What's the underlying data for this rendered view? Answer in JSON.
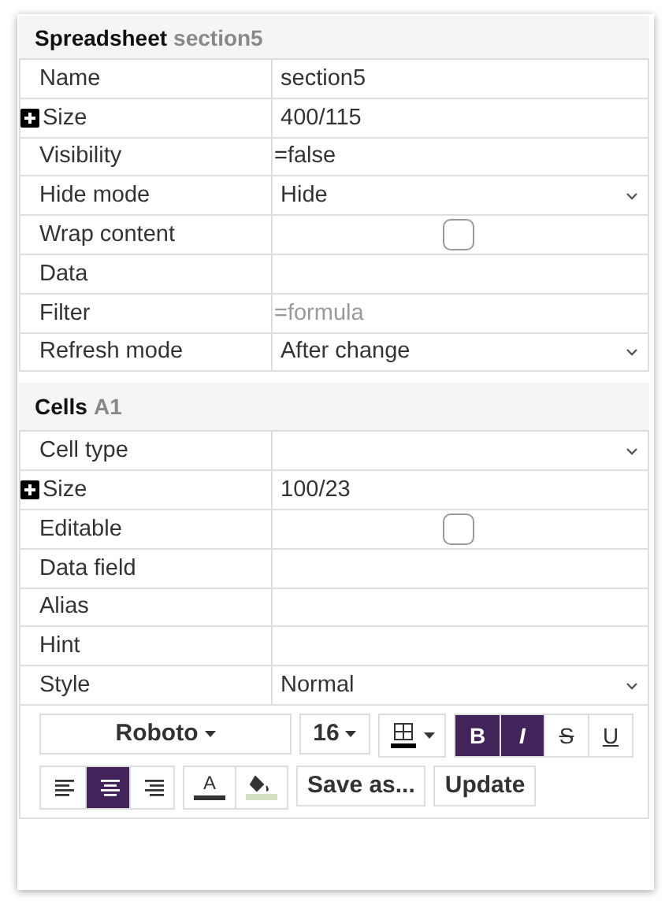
{
  "sections": [
    {
      "title": "Spreadsheet",
      "subtitle": "section5",
      "rows": [
        {
          "label": "Name",
          "kind": "text",
          "value": "section5",
          "expandable": false
        },
        {
          "label": "Size",
          "kind": "text",
          "value": "400/115",
          "expandable": true
        },
        {
          "label": "Visibility",
          "kind": "formula",
          "value": "=false",
          "expandable": false
        },
        {
          "label": "Hide mode",
          "kind": "select",
          "value": "Hide",
          "expandable": false
        },
        {
          "label": "Wrap content",
          "kind": "checkbox",
          "checked": false,
          "expandable": false
        },
        {
          "label": "Data",
          "kind": "text",
          "expandable": false
        },
        {
          "label": "Filter",
          "kind": "formula",
          "placeholder": "=formula",
          "expandable": false
        },
        {
          "label": "Refresh mode",
          "kind": "select",
          "value": "After change",
          "expandable": false
        }
      ]
    },
    {
      "title": "Cells",
      "subtitle": "A1",
      "rows": [
        {
          "label": "Cell type",
          "kind": "select",
          "expandable": false
        },
        {
          "label": "Size",
          "kind": "text",
          "value": "100/23",
          "expandable": true
        },
        {
          "label": "Editable",
          "kind": "checkbox",
          "checked": false,
          "expandable": false
        },
        {
          "label": "Data field",
          "kind": "text",
          "expandable": false
        },
        {
          "label": "Alias",
          "kind": "text",
          "expandable": false
        },
        {
          "label": "Hint",
          "kind": "text",
          "expandable": false
        },
        {
          "label": "Style",
          "kind": "select",
          "value": "Normal",
          "expandable": false
        }
      ]
    }
  ],
  "toolbar": {
    "font": "Roboto",
    "font_size": "16",
    "styles": [
      {
        "label": "B",
        "kind": "bold",
        "selected": true
      },
      {
        "label": "I",
        "kind": "italic",
        "selected": true
      },
      {
        "label": "S",
        "kind": "strike",
        "selected": false
      },
      {
        "label": "U",
        "kind": "underline",
        "selected": false
      }
    ],
    "aligns": [
      {
        "kind": "left",
        "selected": false
      },
      {
        "kind": "center",
        "selected": true
      },
      {
        "kind": "right",
        "selected": false
      }
    ],
    "text_color": {
      "label": "A",
      "color": "#333333"
    },
    "fill_color": {
      "color": "#d4e2c4"
    },
    "buttons": [
      "Save as...",
      "Update"
    ]
  }
}
